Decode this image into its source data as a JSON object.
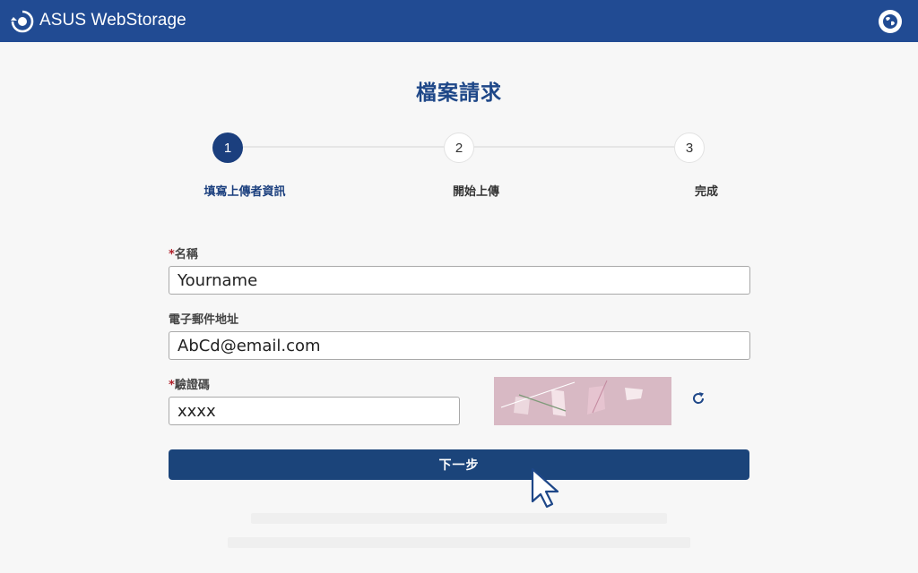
{
  "header": {
    "brand": "ASUS WebStorage",
    "logo_icon": "webstorage-logo-icon",
    "globe_icon": "globe-icon",
    "bar_color": "#214b93"
  },
  "page": {
    "title": "檔案請求"
  },
  "steps": [
    {
      "number": "1",
      "label": "填寫上傳者資訊",
      "state": "active"
    },
    {
      "number": "2",
      "label": "開始上傳",
      "state": "inactive"
    },
    {
      "number": "3",
      "label": "完成",
      "state": "inactive"
    }
  ],
  "form": {
    "name": {
      "required_mark": "*",
      "label": "名稱",
      "value": "Yourname"
    },
    "email": {
      "label": "電子郵件地址",
      "value": "AbCd@email.com"
    },
    "captcha": {
      "required_mark": "*",
      "label": "驗證碼",
      "value": "xxxx",
      "refresh_icon": "refresh-icon"
    },
    "next_label": "下一步"
  },
  "colors": {
    "accent": "#1b3f7e",
    "button": "#1b447a",
    "required": "#b0202a",
    "captcha_bg": "#d8b9c4"
  }
}
